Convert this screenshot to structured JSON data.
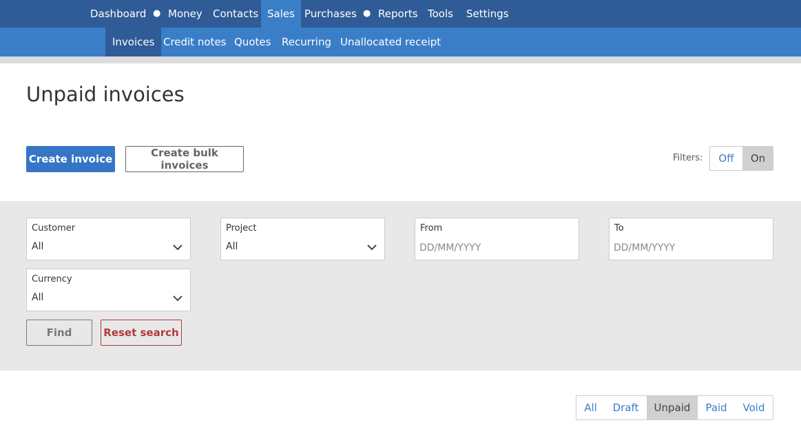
{
  "topnav": {
    "items": [
      "Dashboard",
      "Money",
      "Contacts",
      "Sales",
      "Purchases",
      "Reports",
      "Tools",
      "Settings"
    ],
    "active": "Sales"
  },
  "subnav": {
    "items": [
      "Invoices",
      "Credit notes",
      "Quotes",
      "Recurring",
      "Unallocated receipt"
    ],
    "active": "Invoices"
  },
  "page": {
    "title": "Unpaid invoices"
  },
  "actions": {
    "create_invoice": "Create invoice",
    "create_bulk_invoices": "Create bulk invoices"
  },
  "filters": {
    "label": "Filters:",
    "off": "Off",
    "on": "On",
    "selected": "On"
  },
  "search": {
    "customer": {
      "label": "Customer",
      "value": "All"
    },
    "project": {
      "label": "Project",
      "value": "All"
    },
    "from": {
      "label": "From",
      "placeholder": "DD/MM/YYYY"
    },
    "to": {
      "label": "To",
      "placeholder": "DD/MM/YYYY"
    },
    "currency": {
      "label": "Currency",
      "value": "All"
    },
    "find": "Find",
    "reset": "Reset search"
  },
  "status_tabs": {
    "items": [
      "All",
      "Draft",
      "Unpaid",
      "Paid",
      "Void"
    ],
    "active": "Unpaid"
  },
  "colors": {
    "topnav_bg": "#2f5c96",
    "subnav_bg": "#3a7ec8",
    "primary_button": "#3575c6",
    "reset_button": "#b23a3a",
    "filter_panel_bg": "#e8e8e8"
  }
}
